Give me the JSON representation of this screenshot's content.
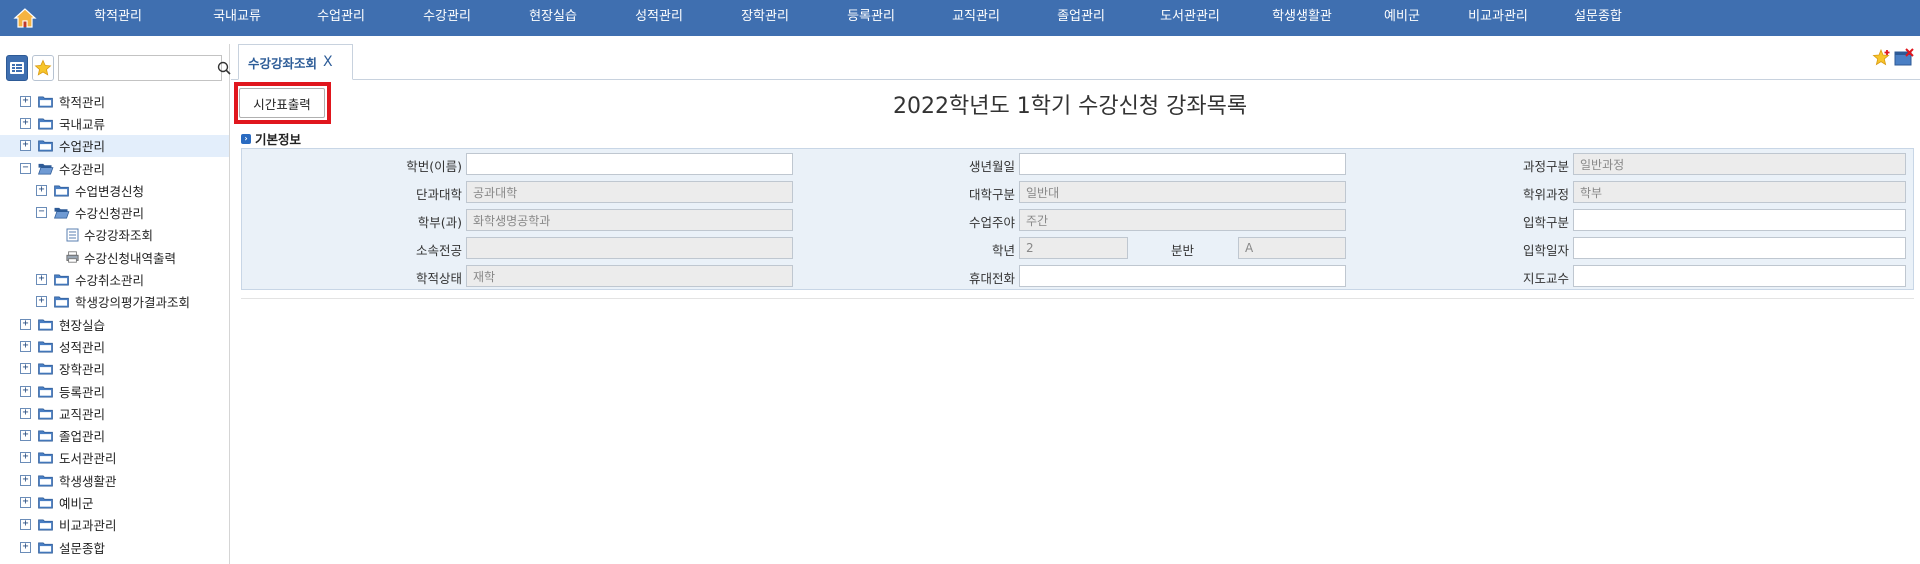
{
  "topnav": {
    "home_icon": "home-icon",
    "items": [
      "학적관리",
      "국내교류",
      "수업관리",
      "수강관리",
      "현장실습",
      "성적관리",
      "장학관리",
      "등록관리",
      "교직관리",
      "졸업관리",
      "도서관관리",
      "학생생활관",
      "예비군",
      "비교과관리",
      "설문종합"
    ]
  },
  "sidebar": {
    "tools": [
      "menu-tree-icon",
      "favorites-star-icon"
    ],
    "search": {
      "value": "",
      "icon": "search-icon"
    },
    "tree": [
      {
        "label": "학적관리",
        "level": 0,
        "type": "folder",
        "toggle": "+"
      },
      {
        "label": "국내교류",
        "level": 0,
        "type": "folder",
        "toggle": "+"
      },
      {
        "label": "수업관리",
        "level": 0,
        "type": "folder",
        "toggle": "+",
        "selected": true
      },
      {
        "label": "수강관리",
        "level": 0,
        "type": "folder-open",
        "toggle": "−"
      },
      {
        "label": "수업변경신청",
        "level": 1,
        "type": "folder",
        "toggle": "+"
      },
      {
        "label": "수강신청관리",
        "level": 1,
        "type": "folder-open",
        "toggle": "−"
      },
      {
        "label": "수강강좌조회",
        "level": 2,
        "type": "doc"
      },
      {
        "label": "수강신청내역출력",
        "level": 2,
        "type": "print"
      },
      {
        "label": "수강취소관리",
        "level": 1,
        "type": "folder",
        "toggle": "+"
      },
      {
        "label": "학생강의평가결과조회",
        "level": 1,
        "type": "folder",
        "toggle": "+"
      },
      {
        "label": "현장실습",
        "level": 0,
        "type": "folder",
        "toggle": "+"
      },
      {
        "label": "성적관리",
        "level": 0,
        "type": "folder",
        "toggle": "+"
      },
      {
        "label": "장학관리",
        "level": 0,
        "type": "folder",
        "toggle": "+"
      },
      {
        "label": "등록관리",
        "level": 0,
        "type": "folder",
        "toggle": "+"
      },
      {
        "label": "교직관리",
        "level": 0,
        "type": "folder",
        "toggle": "+"
      },
      {
        "label": "졸업관리",
        "level": 0,
        "type": "folder",
        "toggle": "+"
      },
      {
        "label": "도서관관리",
        "level": 0,
        "type": "folder",
        "toggle": "+"
      },
      {
        "label": "학생생활관",
        "level": 0,
        "type": "folder",
        "toggle": "+"
      },
      {
        "label": "예비군",
        "level": 0,
        "type": "folder",
        "toggle": "+"
      },
      {
        "label": "비교과관리",
        "level": 0,
        "type": "folder",
        "toggle": "+"
      },
      {
        "label": "설문종합",
        "level": 0,
        "type": "folder",
        "toggle": "+"
      }
    ]
  },
  "tabs": {
    "active_label": "수강강좌조회",
    "close": "X"
  },
  "toolbar": {
    "print_label": "시간표출력"
  },
  "page": {
    "title": "2022학년도 1학기 수강신청 강좌목록"
  },
  "info": {
    "section_title": "기본정보",
    "fields": {
      "student_id": {
        "label": "학번(이름)",
        "value": ""
      },
      "birth": {
        "label": "생년월일",
        "value": ""
      },
      "course_type": {
        "label": "과정구분",
        "value": "일반과정"
      },
      "college": {
        "label": "단과대학",
        "value": "공과대학"
      },
      "univ_type": {
        "label": "대학구분",
        "value": "일반대"
      },
      "degree": {
        "label": "학위과정",
        "value": "학부"
      },
      "dept": {
        "label": "학부(과)",
        "value": "화학생명공학과"
      },
      "day_night": {
        "label": "수업주야",
        "value": "주간"
      },
      "admission_type": {
        "label": "입학구분",
        "value": ""
      },
      "major": {
        "label": "소속전공",
        "value": ""
      },
      "grade": {
        "label": "학년",
        "value": "2"
      },
      "section": {
        "label": "분반",
        "value": "A"
      },
      "admission_date": {
        "label": "입학일자",
        "value": ""
      },
      "status": {
        "label": "학적상태",
        "value": "재학"
      },
      "mobile": {
        "label": "휴대전화",
        "value": ""
      },
      "advisor": {
        "label": "지도교수",
        "value": ""
      }
    }
  },
  "colors": {
    "nav_bg": "#3f6fb0",
    "highlight": "#e0161d",
    "panel_bg": "#eaf1f8"
  }
}
